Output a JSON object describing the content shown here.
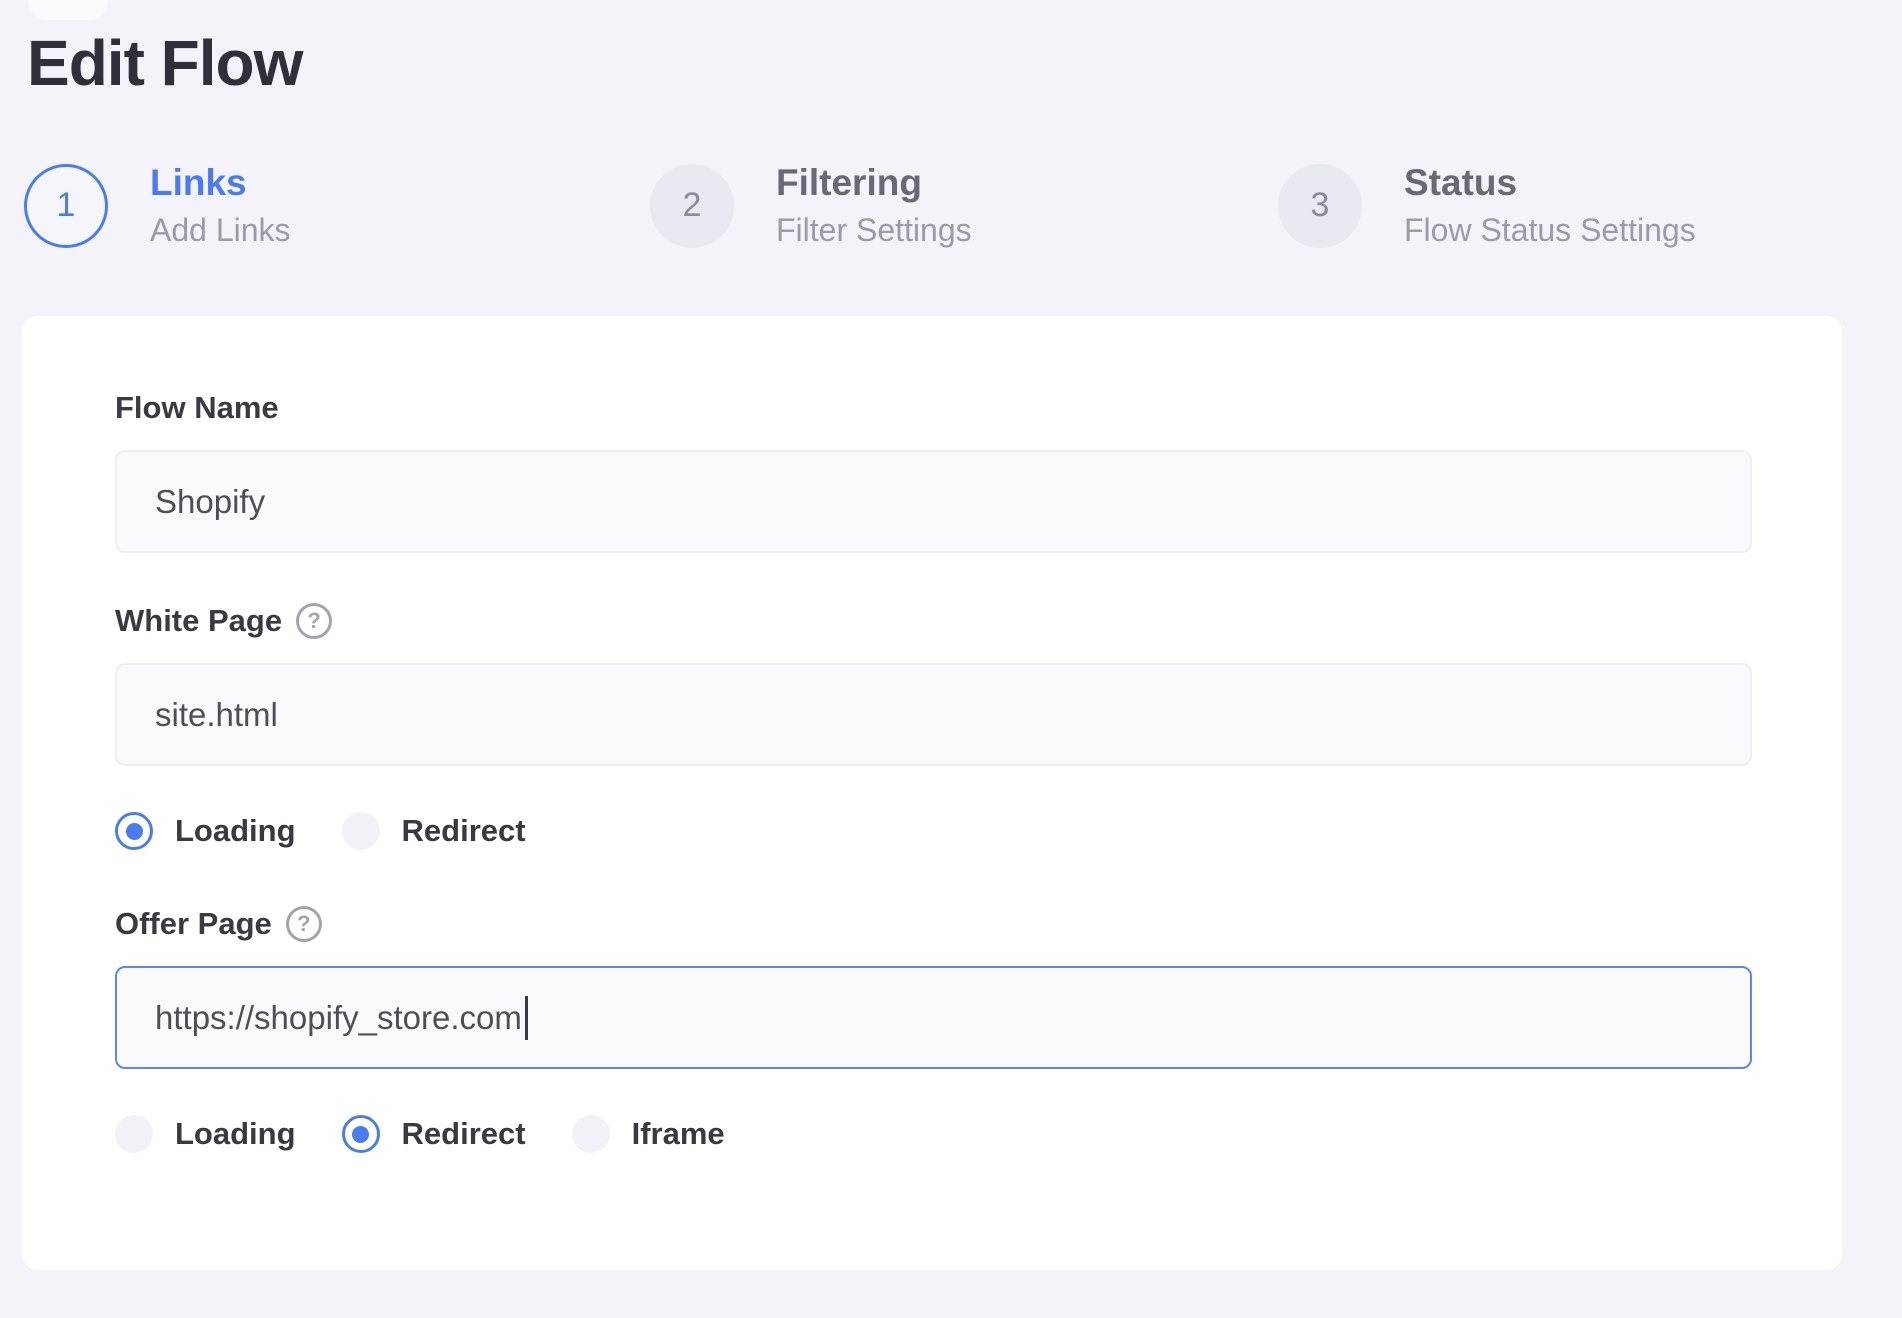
{
  "page": {
    "title": "Edit Flow"
  },
  "stepper": {
    "steps": [
      {
        "number": "1",
        "title": "Links",
        "subtitle": "Add Links",
        "active": true
      },
      {
        "number": "2",
        "title": "Filtering",
        "subtitle": "Filter Settings",
        "active": false
      },
      {
        "number": "3",
        "title": "Status",
        "subtitle": "Flow Status Settings",
        "active": false
      }
    ]
  },
  "form": {
    "flow_name": {
      "label": "Flow Name",
      "value": "Shopify"
    },
    "white_page": {
      "label": "White Page",
      "value": "site.html",
      "options": [
        {
          "label": "Loading",
          "selected": true
        },
        {
          "label": "Redirect",
          "selected": false
        }
      ]
    },
    "offer_page": {
      "label": "Offer Page",
      "value": "https://shopify_store.com",
      "focused": true,
      "options": [
        {
          "label": "Loading",
          "selected": false
        },
        {
          "label": "Redirect",
          "selected": true
        },
        {
          "label": "Iframe",
          "selected": false
        }
      ]
    }
  },
  "icons": {
    "help_glyph": "?"
  },
  "colors": {
    "accent_blue": "#4a7cf0",
    "page_background": "#f3f3f9",
    "card_background": "#ffffff",
    "title_text": "#30303a",
    "inactive_step_circle": "#e9e9f1",
    "muted_text": "#9b9ba6",
    "input_background": "#fafafc",
    "input_border": "#efeff6",
    "focused_input_border": "#5b87f2"
  }
}
